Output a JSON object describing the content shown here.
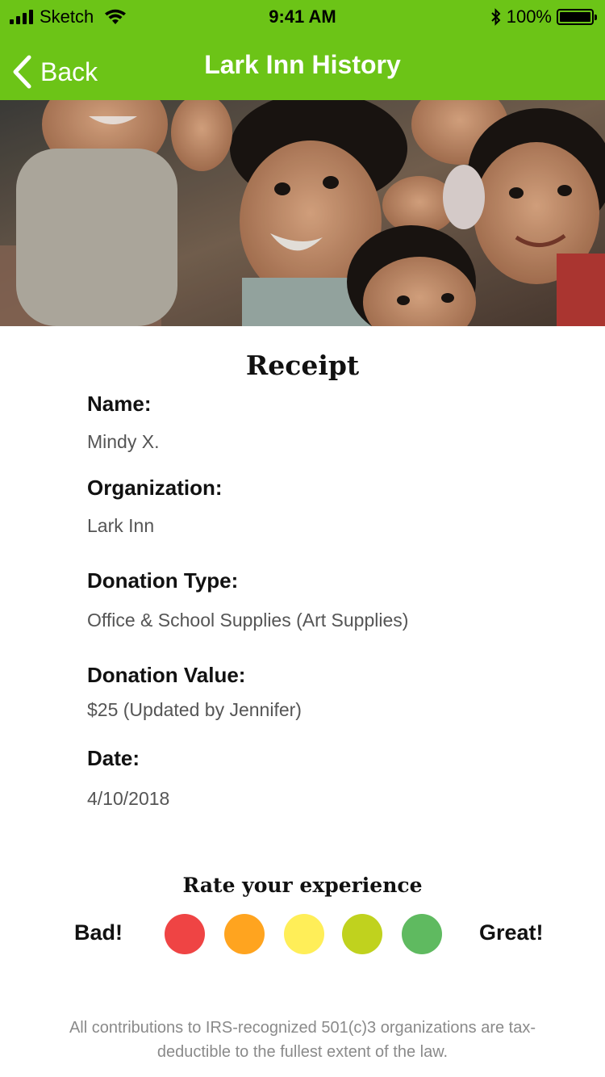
{
  "status_bar": {
    "carrier": "Sketch",
    "time": "9:41 AM",
    "battery": "100%"
  },
  "nav": {
    "back_label": "Back",
    "title": "Lark Inn History"
  },
  "colors": {
    "header": "#6cc417",
    "rating": [
      "#ef4444",
      "#ffa41f",
      "#ffee58",
      "#c0d21e",
      "#5fba60"
    ]
  },
  "receipt": {
    "title": "Receipt",
    "fields": [
      {
        "label": "Name:",
        "value": "Mindy X."
      },
      {
        "label": "Organization:",
        "value": "Lark Inn"
      },
      {
        "label": "Donation Type:",
        "value": "Office & School Supplies (Art Supplies)"
      },
      {
        "label": "Donation Value:",
        "value": "$25 (Updated by Jennifer)"
      },
      {
        "label": "Date:",
        "value": "4/10/2018"
      }
    ]
  },
  "rating": {
    "title": "Rate your experience",
    "low_label": "Bad!",
    "high_label": "Great!"
  },
  "footer": {
    "note": "All contributions to IRS-recognized 501(c)3 organizations are tax-deductible to the fullest extent of the law."
  }
}
